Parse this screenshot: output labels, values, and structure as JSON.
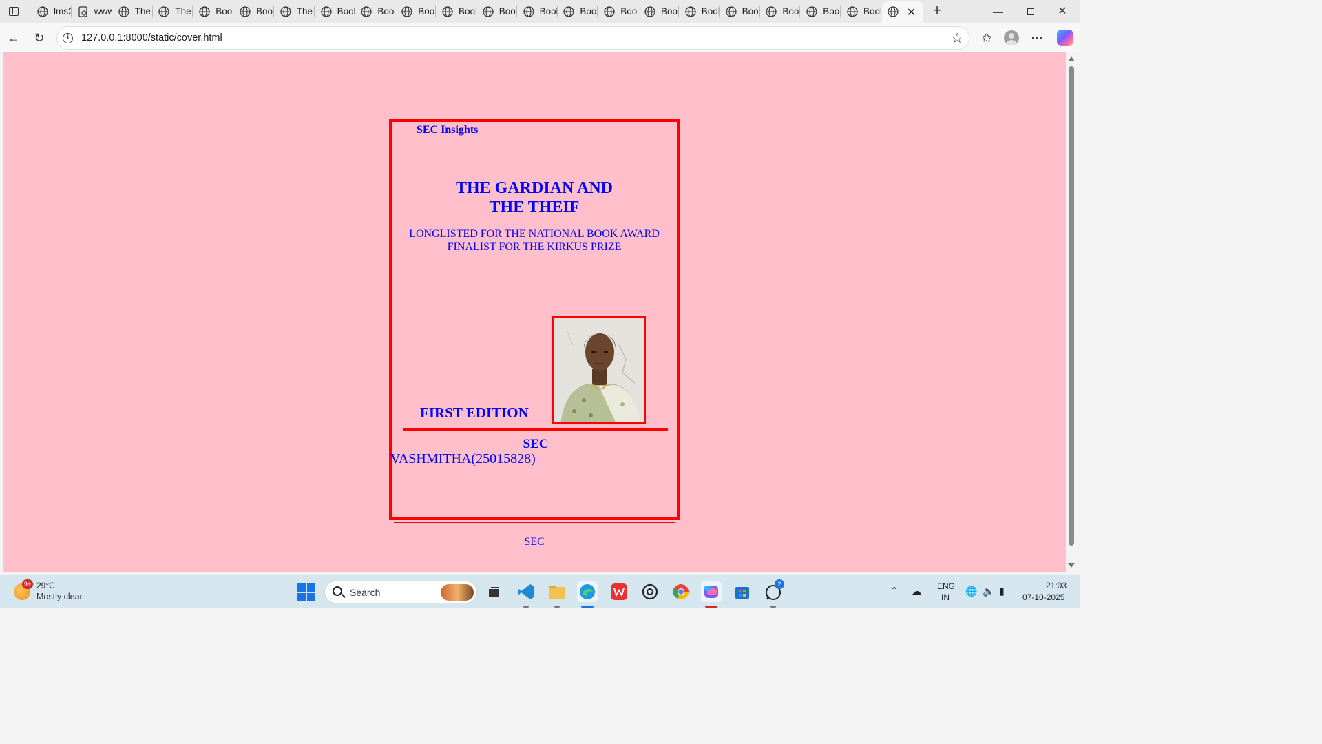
{
  "browser": {
    "tabs": [
      {
        "title": "lms2",
        "icon": "globe-icon"
      },
      {
        "title": "www",
        "icon": "pdf-file-icon"
      },
      {
        "title": "The",
        "icon": "globe-icon"
      },
      {
        "title": "The",
        "icon": "globe-icon"
      },
      {
        "title": "Book",
        "icon": "globe-icon"
      },
      {
        "title": "Book",
        "icon": "globe-icon"
      },
      {
        "title": "The",
        "icon": "globe-icon"
      },
      {
        "title": "Book",
        "icon": "globe-icon"
      },
      {
        "title": "Book",
        "icon": "globe-icon"
      },
      {
        "title": "Book",
        "icon": "globe-icon"
      },
      {
        "title": "Book",
        "icon": "globe-icon"
      },
      {
        "title": "Book",
        "icon": "globe-icon"
      },
      {
        "title": "Book",
        "icon": "globe-icon"
      },
      {
        "title": "Book",
        "icon": "globe-icon"
      },
      {
        "title": "Book",
        "icon": "globe-icon"
      },
      {
        "title": "Book",
        "icon": "globe-icon"
      },
      {
        "title": "Book",
        "icon": "globe-icon"
      },
      {
        "title": "Book",
        "icon": "globe-icon"
      },
      {
        "title": "Book",
        "icon": "globe-icon"
      },
      {
        "title": "Book",
        "icon": "globe-icon"
      },
      {
        "title": "Book",
        "icon": "globe-icon"
      }
    ],
    "active_tab_close": "✕",
    "new_tab": "+",
    "url": "127.0.0.1:8000/static/cover.html"
  },
  "page": {
    "background": "#ffc0cb",
    "text_color": "#0000ff",
    "border_color": "#ff0000",
    "brand": "SEC Insights",
    "title_line1": "THE GARDIAN AND",
    "title_line2": "THE THEIF",
    "award1": "LONGLISTED FOR THE NATIONAL BOOK AWARD",
    "award2": "FINALIST FOR THE KIRKUS PRIZE",
    "edition": "FIRST EDITION",
    "photo": "author-photo",
    "publisher": "SEC",
    "author": "VASHMITHA(25015828)",
    "footer": "SEC"
  },
  "taskbar": {
    "weather_badge": "9+",
    "weather_temp": "29°C",
    "weather_desc": "Mostly clear",
    "search_label": "Search",
    "apps": [
      "task-view-icon",
      "vscode-icon",
      "file-explorer-icon",
      "edge-icon",
      "wps-office-icon",
      "chatgpt-icon",
      "chrome-icon",
      "copilot-icon",
      "microsoft-store-icon",
      "whatsapp-icon"
    ],
    "whatsapp_badge": "2",
    "lang1": "ENG",
    "lang2": "IN",
    "time": "21:03",
    "date": "07-10-2025"
  }
}
